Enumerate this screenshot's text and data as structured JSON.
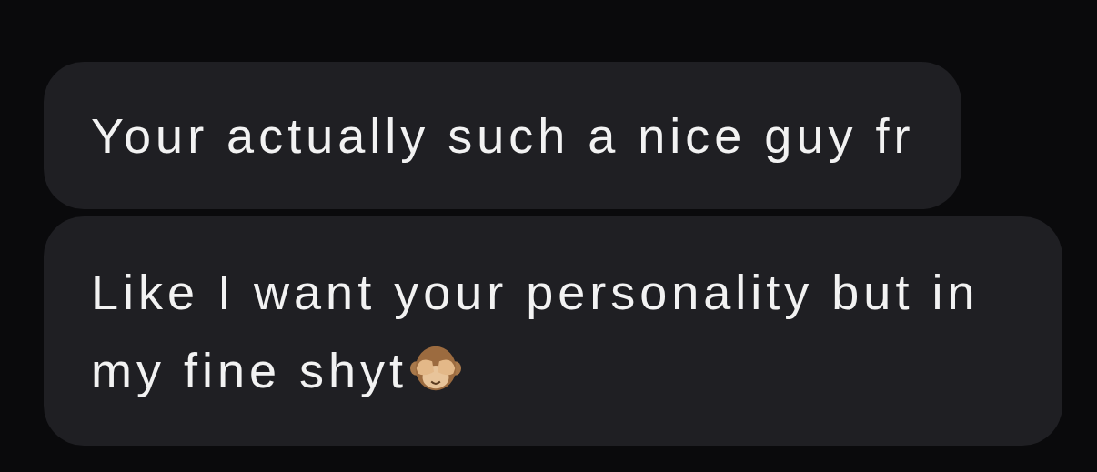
{
  "messages": [
    {
      "text": "Your actually such a nice guy fr",
      "emoji": false
    },
    {
      "text": "Like I want your personality but in my fine shyt",
      "emoji": true
    }
  ]
}
